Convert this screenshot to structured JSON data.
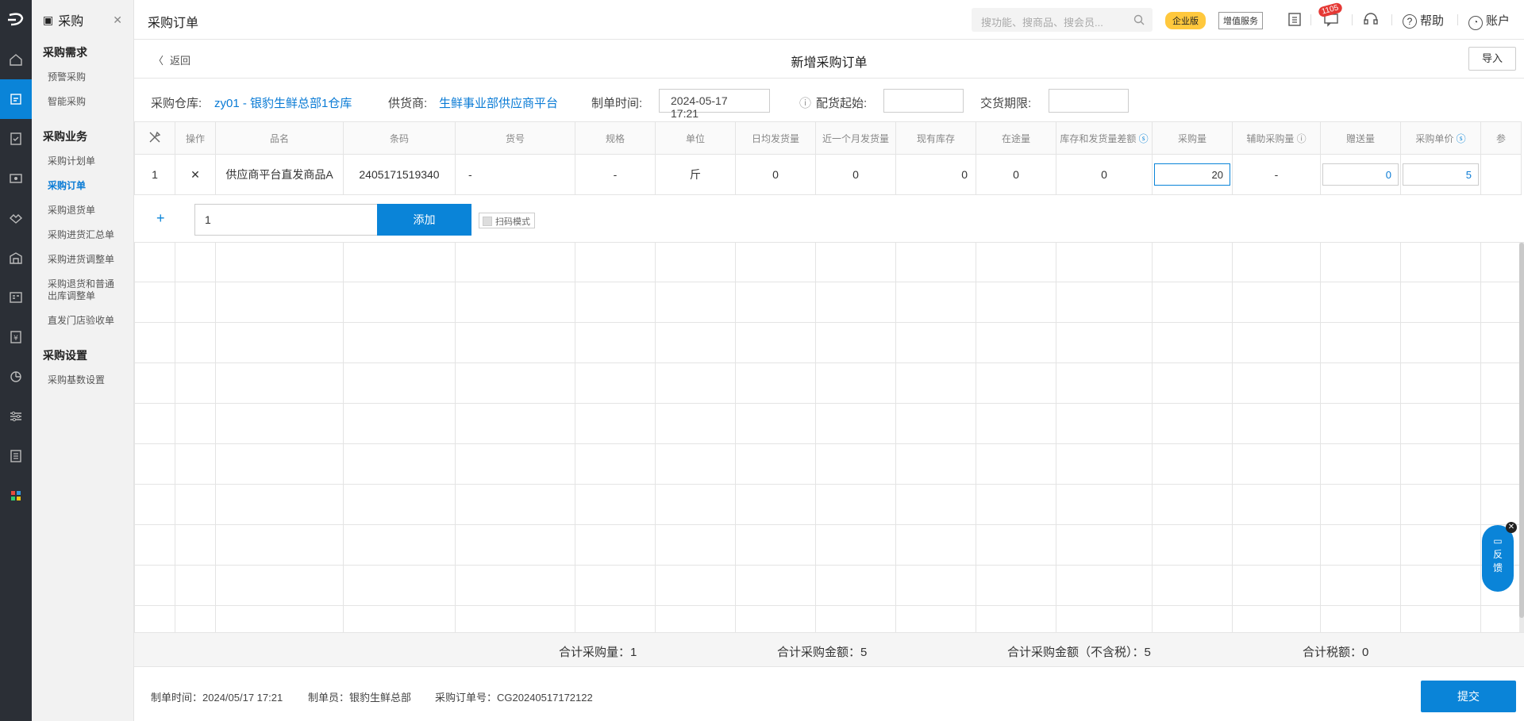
{
  "rail": {
    "logo": "⊃",
    "items": [
      "home-icon",
      "purchase-icon",
      "order-icon",
      "monitor-icon",
      "handshake-icon",
      "warehouse-icon",
      "report-icon",
      "finance-icon",
      "chart-icon",
      "settings-icon",
      "inventory-icon",
      "apps-icon"
    ]
  },
  "sidebar": {
    "module": "采购",
    "groups": [
      {
        "title": "采购需求",
        "items": [
          "预警采购",
          "智能采购"
        ]
      },
      {
        "title": "采购业务",
        "items": [
          "采购计划单",
          "采购订单",
          "采购退货单",
          "采购进货汇总单",
          "采购进货调整单",
          "采购退货和普通出库调整单",
          "直发门店验收单"
        ]
      },
      {
        "title": "采购设置",
        "items": [
          "采购基数设置"
        ]
      }
    ]
  },
  "topbar": {
    "title": "采购订单",
    "search_placeholder": "搜功能、搜商品、搜会员...",
    "badge_enterprise": "企业版",
    "badge_vas": "增值服务",
    "msg_count": "1105",
    "help": "帮助",
    "account": "账户"
  },
  "page": {
    "back": "返回",
    "title": "新增采购订单",
    "import": "导入"
  },
  "form": {
    "warehouse_label": "采购仓库:",
    "warehouse_value": "zy01 - 银豹生鲜总部1仓库",
    "supplier_label": "供货商:",
    "supplier_value": "生鲜事业部供应商平台",
    "time_label": "制单时间:",
    "time_value": "2024-05-17 17:21",
    "dist_label": "配货起始:",
    "deadline_label": "交货期限:"
  },
  "table": {
    "headers": [
      "操作",
      "品名",
      "条码",
      "货号",
      "规格",
      "单位",
      "日均发货量",
      "近一个月发货量",
      "现有库存",
      "在途量",
      "库存和发货量差额",
      "采购量",
      "辅助采购量",
      "赠送量",
      "采购单价",
      "参"
    ],
    "row": {
      "index": "1",
      "op": "✕",
      "name": "供应商平台直发商品A",
      "barcode": "2405171519340",
      "code": "-",
      "spec": "-",
      "unit": "斤",
      "daily": "0",
      "month": "0",
      "stock": "0",
      "transit": "0",
      "diff": "0",
      "qty": "20",
      "aux": "-",
      "gift": "0",
      "price": "5"
    }
  },
  "addrow": {
    "qty": "1",
    "add": "添加",
    "scan": "扫码模式"
  },
  "totals": {
    "qty": "合计采购量：1",
    "amount": "合计采购金额：5",
    "amount_notax": "合计采购金额（不含税）：5",
    "tax": "合计税额：0"
  },
  "footer": {
    "time": "制单时间：2024/05/17 17:21",
    "maker": "制单员：银豹生鲜总部",
    "order_no": "采购订单号：CG20240517172122",
    "submit": "提交"
  },
  "feedback": {
    "line1": "反",
    "line2": "馈"
  }
}
